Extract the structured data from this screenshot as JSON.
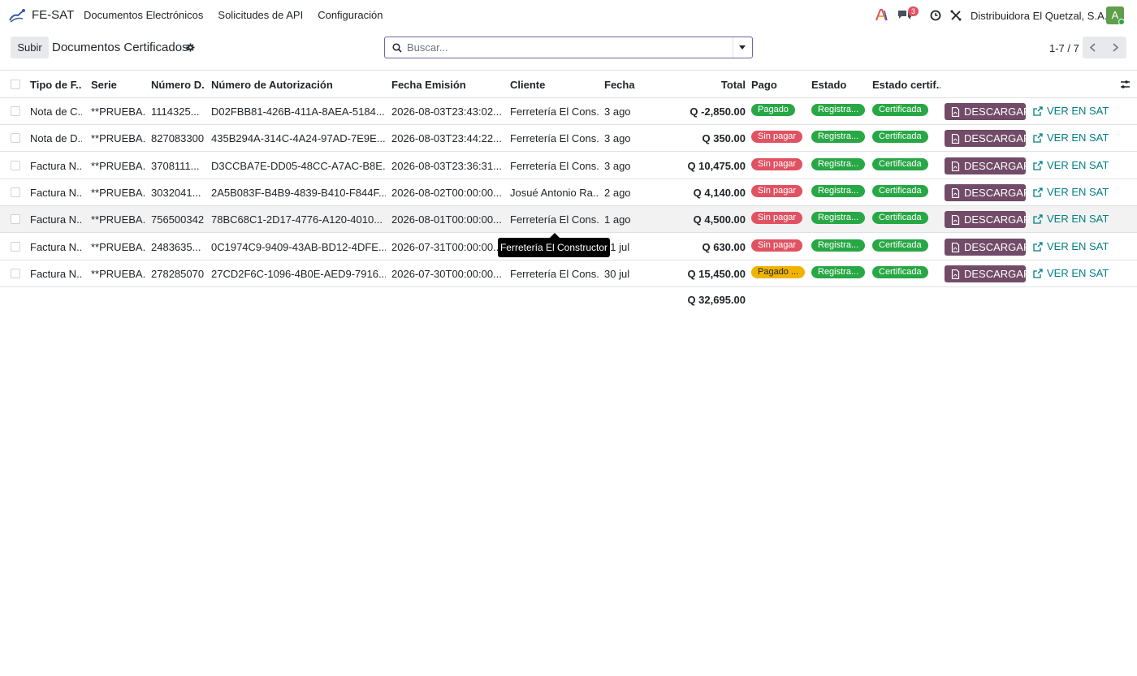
{
  "app": {
    "name": "FE-SAT"
  },
  "nav": {
    "items": [
      "Documentos Electrónicos",
      "Solicitudes de API",
      "Configuración"
    ]
  },
  "systray": {
    "chat_count": "3",
    "company": "Distribuidora El Quetzal, S.A.",
    "avatar_letter": "A"
  },
  "control_panel": {
    "upload_label": "Subir",
    "title": "Documentos Certificados",
    "search_placeholder": "Buscar...",
    "pager": "1-7 / 7"
  },
  "table": {
    "headers": [
      "Tipo de F...",
      "Serie",
      "Número D...",
      "Número de Autorización",
      "Fecha Emisión",
      "Cliente",
      "Fecha",
      "Total",
      "Pago",
      "Estado",
      "Estado certif..."
    ],
    "rows": [
      {
        "tipo": "Nota de C...",
        "serie": "**PRUEBA...",
        "numero": "1114325...",
        "autorizacion": "D02FBB81-426B-411A-8AEA-5184...",
        "emision": "2026-08-03T23:43:02...",
        "cliente": "Ferretería El Cons...",
        "fecha": "3 ago",
        "total": "Q -2,850.00",
        "pago": "Pagado",
        "estado": "Registra...",
        "certificado": "Certificada",
        "descargar": "DESCARGAR",
        "ver": "VER EN SAT"
      },
      {
        "tipo": "Nota de D...",
        "serie": "**PRUEBA...",
        "numero": "827083300",
        "autorizacion": "435B294A-314C-4A24-97AD-7E9E...",
        "emision": "2026-08-03T23:44:22...",
        "cliente": "Ferretería El Cons...",
        "fecha": "3 ago",
        "total": "Q 350.00",
        "pago": "Sin pagar",
        "estado": "Registra...",
        "certificado": "Certificada",
        "descargar": "DESCARGAR",
        "ver": "VER EN SAT"
      },
      {
        "tipo": "Factura N...",
        "serie": "**PRUEBA...",
        "numero": "3708111...",
        "autorizacion": "D3CCBA7E-DD05-48CC-A7AC-B8E...",
        "emision": "2026-08-03T23:36:31...",
        "cliente": "Ferretería El Cons...",
        "fecha": "3 ago",
        "total": "Q 10,475.00",
        "pago": "Sin pagar",
        "estado": "Registra...",
        "certificado": "Certificada",
        "descargar": "DESCARGAR",
        "ver": "VER EN SAT"
      },
      {
        "tipo": "Factura N...",
        "serie": "**PRUEBA...",
        "numero": "3032041...",
        "autorizacion": "2A5B083F-B4B9-4839-B410-F844F...",
        "emision": "2026-08-02T00:00:00...",
        "cliente": "Josué Antonio Ra...",
        "fecha": "2 ago",
        "total": "Q 4,140.00",
        "pago": "Sin pagar",
        "estado": "Registra...",
        "certificado": "Certificada",
        "descargar": "DESCARGAR",
        "ver": "VER EN SAT"
      },
      {
        "tipo": "Factura N...",
        "serie": "**PRUEBA...",
        "numero": "756500342",
        "autorizacion": "78BC68C1-2D17-4776-A120-4010...",
        "emision": "2026-08-01T00:00:00...",
        "cliente": "Ferretería El Cons...",
        "fecha": "1 ago",
        "total": "Q 4,500.00",
        "pago": "Sin pagar",
        "estado": "Registra...",
        "certificado": "Certificada",
        "descargar": "DESCARGAR",
        "ver": "VER EN SAT"
      },
      {
        "tipo": "Factura N...",
        "serie": "**PRUEBA...",
        "numero": "2483635...",
        "autorizacion": "0C1974C9-9409-43AB-BD12-4DFE...",
        "emision": "2026-07-31T00:00:00...",
        "cliente": "",
        "fecha": "31 jul",
        "total": "Q 630.00",
        "pago": "Sin pagar",
        "estado": "Registra...",
        "certificado": "Certificada",
        "descargar": "DESCARGAR",
        "ver": "VER EN SAT"
      },
      {
        "tipo": "Factura N...",
        "serie": "**PRUEBA...",
        "numero": "278285070",
        "autorizacion": "27CD2F6C-1096-4B0E-AED9-7916...",
        "emision": "2026-07-30T00:00:00...",
        "cliente": "Ferretería El Cons...",
        "fecha": "30 jul",
        "total": "Q 15,450.00",
        "pago": "Pagado ...",
        "estado": "Registra...",
        "certificado": "Certificada",
        "descargar": "DESCARGAR",
        "ver": "VER EN SAT"
      }
    ],
    "grand_total": "Q 32,695.00"
  },
  "tooltip": {
    "text": "Ferretería El Constructor"
  },
  "colors": {
    "pagado": "#28a745",
    "sin_pagar": "#e05262",
    "pagado_parcial": "#f0b400",
    "registrado": "#28a745",
    "certificada": "#28a745",
    "download_btn": "#714b67",
    "link": "#017e84"
  }
}
